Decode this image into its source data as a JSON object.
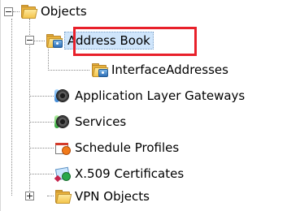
{
  "tree": {
    "nodes": [
      {
        "id": "objects",
        "label": "Objects",
        "icon": "folder-icon",
        "toggle": "minus"
      },
      {
        "id": "address-book",
        "label": "Address Book",
        "icon": "address-book-folder-icon",
        "toggle": "minus",
        "selected": true,
        "highlighted": true
      },
      {
        "id": "interface-addresses",
        "label": "InterfaceAddresses",
        "icon": "address-folder-icon",
        "toggle": null
      },
      {
        "id": "alg",
        "label": "Application Layer Gateways",
        "icon": "gear-icon",
        "toggle": null
      },
      {
        "id": "services",
        "label": "Services",
        "icon": "services-gear-icon",
        "toggle": null
      },
      {
        "id": "schedule-profiles",
        "label": "Schedule Profiles",
        "icon": "calendar-clock-icon",
        "toggle": null
      },
      {
        "id": "x509",
        "label": "X.509 Certificates",
        "icon": "certificate-icon",
        "toggle": null
      },
      {
        "id": "vpn-objects",
        "label": "VPN Objects",
        "icon": "folder-icon",
        "toggle": "plus"
      }
    ],
    "highlight_color": "#e8202a",
    "selection_color": "#cfe5fb"
  }
}
